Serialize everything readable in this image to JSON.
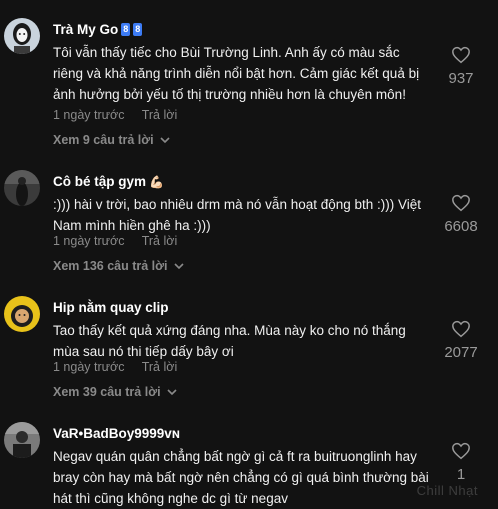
{
  "comments": [
    {
      "username": "Trà My Go",
      "badges": [
        "8",
        "8"
      ],
      "text": "Tôi vẫn thấy tiếc cho Bùi Trường Linh. Anh ấy có màu sắc riêng và khả năng trình diễn nổi bật hơn. Cảm giác kết quả bị ảnh hưởng bởi yếu tố thị trường nhiều hơn là chuyên môn!",
      "time": "1 ngày trước",
      "reply": "Trả lời",
      "view_replies": "Xem 9 câu trả lời",
      "likes": "937"
    },
    {
      "username": "Cô bé tập gym",
      "emoji": "💪🏻",
      "text": ":))) hài v trời, bao nhiêu drm mà nó vẫn hoạt động bth :))) Việt Nam mình hiền ghê ha :)))",
      "time": "1 ngày trước",
      "reply": "Trả lời",
      "view_replies": "Xem 136 câu trả lời",
      "likes": "6608"
    },
    {
      "username": "Hip nằm quay clip",
      "text": "Tao thấy kết quả xứng đáng nha. Mùa này ko cho nó thắng mùa sau nó thi tiếp dấy bây ơi",
      "time": "1 ngày trước",
      "reply": "Trả lời",
      "view_replies": "Xem 39 câu trả lời",
      "likes": "2077"
    },
    {
      "username": "VaR•BadBoy9999ᴠɴ",
      "text": "Negav quán quân chẳng bất ngờ gì cả ft ra buitruonglinh hay bray còn hay mà bất ngờ nên chẳng có gì quá bình thường bài hát thì cũng không nghe dc gì từ negav",
      "likes": "1"
    }
  ],
  "watermark": "Chill Nhạt",
  "colors": {
    "background": "#121212",
    "muted": "#8a8a8a",
    "badge": "#3d7cf5"
  }
}
